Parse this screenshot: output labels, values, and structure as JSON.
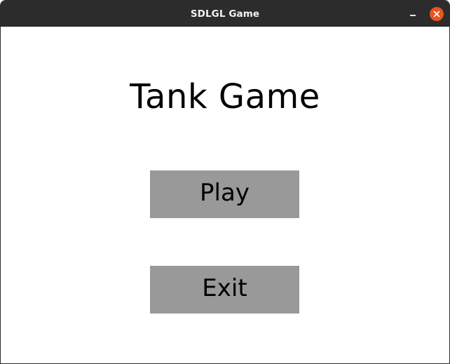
{
  "window": {
    "title": "SDLGL Game"
  },
  "titlebar": {
    "minimize_icon": "minimize-icon",
    "close_icon": "close-icon",
    "close_color": "#e95420"
  },
  "game": {
    "title": "Tank Game",
    "menu": {
      "play_label": "Play",
      "exit_label": "Exit"
    },
    "button_color": "#999999"
  }
}
